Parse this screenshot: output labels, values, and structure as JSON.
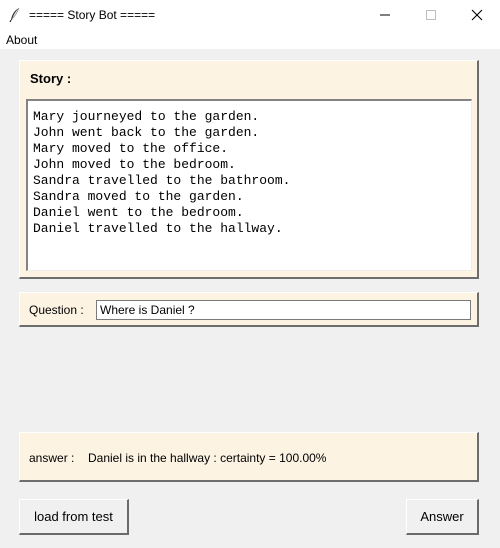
{
  "window": {
    "title": "===== Story Bot =====",
    "app_icon": "feather-icon",
    "controls": [
      "minimize-icon",
      "maximize-icon",
      "close-icon"
    ]
  },
  "menu": {
    "items": [
      "About"
    ]
  },
  "story": {
    "label": "Story :",
    "lines": "Mary journeyed to the garden.\nJohn went back to the garden.\nMary moved to the office.\nJohn moved to the bedroom.\nSandra travelled to the bathroom.\nSandra moved to the garden.\nDaniel went to the bedroom.\nDaniel travelled to the hallway."
  },
  "question": {
    "label": "Question :",
    "value": "Where is Daniel ?"
  },
  "answer": {
    "label": "answer :",
    "value": "Daniel is in the hallway : certainty = 100.00%"
  },
  "buttons": {
    "load": "load from test",
    "answer": "Answer"
  },
  "colors": {
    "frame_background": "#fcf3e3",
    "window_background": "#f0f0f0"
  }
}
